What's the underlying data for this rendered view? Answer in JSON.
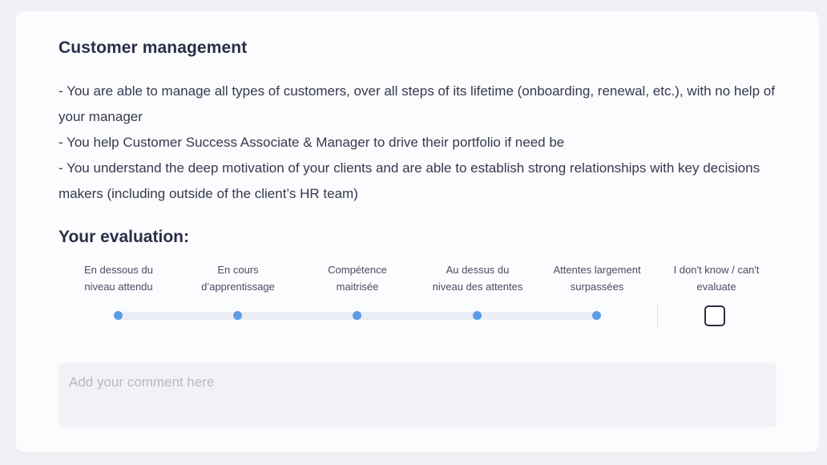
{
  "section": {
    "title": "Customer management",
    "description": [
      "- You are able to manage all types of customers, over all steps of its lifetime (onboarding, renewal, etc.), with no help of your manager",
      "- You help Customer Success Associate & Manager to drive their portfolio if need be",
      "- You understand the deep motivation of your clients and are able to establish strong relationships with key decisions makers (including outside of the client’s HR team)"
    ]
  },
  "evaluation": {
    "title": "Your evaluation:",
    "levels": [
      {
        "line1": "En dessous du",
        "line2": "niveau attendu"
      },
      {
        "line1": "En cours",
        "line2": "d’apprentissage"
      },
      {
        "line1": "Compétence",
        "line2": "maitrisée"
      },
      {
        "line1": "Au dessus du",
        "line2": "niveau des attentes"
      },
      {
        "line1": "Attentes largement",
        "line2": "surpassées"
      }
    ],
    "unknown": {
      "line1": "I don't know / can't",
      "line2": "evaluate",
      "checked": false
    },
    "accent_color": "#5b9be8"
  },
  "comment": {
    "placeholder": "Add your comment here",
    "value": ""
  }
}
